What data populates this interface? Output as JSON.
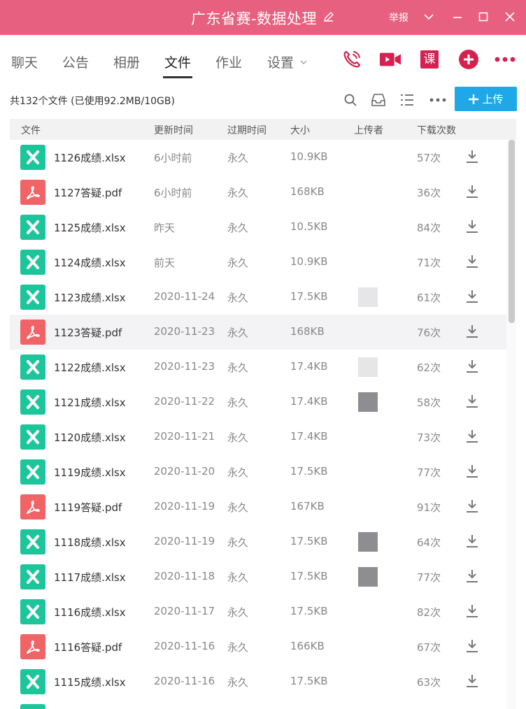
{
  "window": {
    "title": "广东省赛-数据处理",
    "report_label": "举报",
    "icons": [
      "edit-icon",
      "chevron-down-icon",
      "minimize-icon",
      "maximize-icon",
      "close-icon"
    ]
  },
  "tabs": [
    {
      "label": "聊天",
      "active": false
    },
    {
      "label": "公告",
      "active": false
    },
    {
      "label": "相册",
      "active": false
    },
    {
      "label": "文件",
      "active": true
    },
    {
      "label": "作业",
      "active": false
    },
    {
      "label": "设置",
      "active": false
    }
  ],
  "actions": {
    "lesson_label": "课",
    "icons": [
      "phone-icon",
      "video-icon",
      "lesson-icon",
      "plus-circle-icon",
      "more-icon"
    ],
    "accent": "#d6204f"
  },
  "summary": "共132个文件 (已使用92.2MB/10GB)",
  "toolbar": {
    "icons": [
      "search-icon",
      "inbox-icon",
      "list-icon",
      "more-icon"
    ],
    "upload_label": "上传",
    "upload_color": "#1fa8e8"
  },
  "table": {
    "columns": [
      "文件",
      "更新时间",
      "过期时间",
      "大小",
      "上传者",
      "下载次数"
    ],
    "rows": [
      {
        "name": "1126成绩.xlsx",
        "type": "xlsx",
        "updated": "6小时前",
        "expires": "永久",
        "size": "10.9KB",
        "downloads": "57次"
      },
      {
        "name": "1127答疑.pdf",
        "type": "pdf",
        "updated": "6小时前",
        "expires": "永久",
        "size": "168KB",
        "downloads": "36次"
      },
      {
        "name": "1125成绩.xlsx",
        "type": "xlsx",
        "updated": "昨天",
        "expires": "永久",
        "size": "10.5KB",
        "downloads": "84次"
      },
      {
        "name": "1124成绩.xlsx",
        "type": "xlsx",
        "updated": "前天",
        "expires": "永久",
        "size": "10.9KB",
        "downloads": "71次"
      },
      {
        "name": "1123成绩.xlsx",
        "type": "xlsx",
        "updated": "2020-11-24",
        "expires": "永久",
        "size": "17.5KB",
        "downloads": "61次"
      },
      {
        "name": "1123答疑.pdf",
        "type": "pdf",
        "updated": "2020-11-23",
        "expires": "永久",
        "size": "168KB",
        "downloads": "76次"
      },
      {
        "name": "1122成绩.xlsx",
        "type": "xlsx",
        "updated": "2020-11-23",
        "expires": "永久",
        "size": "17.4KB",
        "downloads": "62次"
      },
      {
        "name": "1121成绩.xlsx",
        "type": "xlsx",
        "updated": "2020-11-22",
        "expires": "永久",
        "size": "17.4KB",
        "downloads": "58次"
      },
      {
        "name": "1120成绩.xlsx",
        "type": "xlsx",
        "updated": "2020-11-21",
        "expires": "永久",
        "size": "17.4KB",
        "downloads": "73次"
      },
      {
        "name": "1119成绩.xlsx",
        "type": "xlsx",
        "updated": "2020-11-20",
        "expires": "永久",
        "size": "17.5KB",
        "downloads": "77次"
      },
      {
        "name": "1119答疑.pdf",
        "type": "pdf",
        "updated": "2020-11-19",
        "expires": "永久",
        "size": "167KB",
        "downloads": "91次"
      },
      {
        "name": "1118成绩.xlsx",
        "type": "xlsx",
        "updated": "2020-11-19",
        "expires": "永久",
        "size": "17.5KB",
        "downloads": "64次"
      },
      {
        "name": "1117成绩.xlsx",
        "type": "xlsx",
        "updated": "2020-11-18",
        "expires": "永久",
        "size": "17.5KB",
        "downloads": "77次"
      },
      {
        "name": "1116成绩.xlsx",
        "type": "xlsx",
        "updated": "2020-11-17",
        "expires": "永久",
        "size": "17.5KB",
        "downloads": "82次"
      },
      {
        "name": "1116答疑.pdf",
        "type": "pdf",
        "updated": "2020-11-16",
        "expires": "永久",
        "size": "166KB",
        "downloads": "67次"
      },
      {
        "name": "1115成绩.xlsx",
        "type": "xlsx",
        "updated": "2020-11-16",
        "expires": "永久",
        "size": "17.5KB",
        "downloads": "63次"
      },
      {
        "name": "",
        "type": "xlsx",
        "updated": "",
        "expires": "",
        "size": "",
        "downloads": ""
      }
    ]
  },
  "colors": {
    "titlebar": "#e8607f",
    "xlsx": "#1cc59a",
    "pdf": "#f06467",
    "row_highlight": "#f3f3f5"
  }
}
